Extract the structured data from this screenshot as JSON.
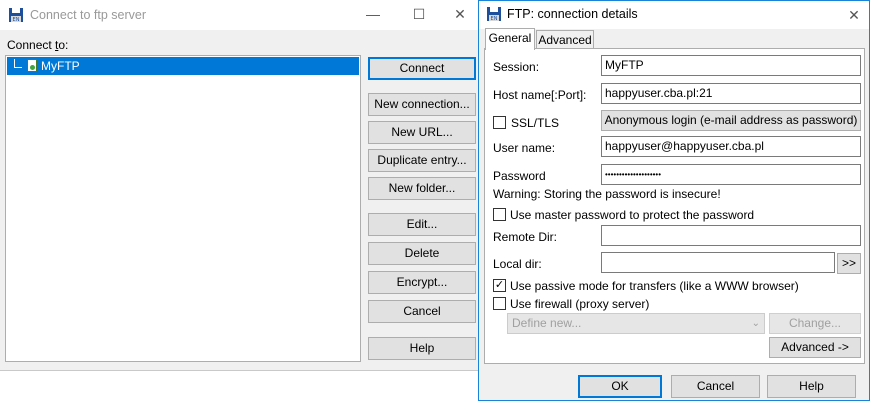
{
  "main_window": {
    "title": "Connect to ftp server",
    "icon": "floppy-disk-icon",
    "controls": {
      "minimize": "—",
      "maximize": "☐",
      "close": "✕"
    },
    "connect_to_label_pre": "Connect ",
    "connect_to_label_ul": "t",
    "connect_to_label_post": "o:",
    "tree_items": [
      {
        "label": "MyFTP",
        "icon": "ftp-site-icon",
        "selected": true
      }
    ],
    "buttons": {
      "connect": "Connect",
      "new_connection": "New connection...",
      "new_url": "New URL...",
      "duplicate_entry": "Duplicate entry...",
      "new_folder": "New folder...",
      "edit": "Edit...",
      "delete": "Delete",
      "encrypt": "Encrypt...",
      "cancel": "Cancel",
      "help": "Help"
    }
  },
  "dialog": {
    "title": "FTP: connection details",
    "close": "✕",
    "tabs": [
      "General",
      "Advanced"
    ],
    "active_tab": "General",
    "session_label": "Session:",
    "session_value": "MyFTP",
    "host_label": "Host name[:Port]:",
    "host_value": "happyuser.cba.pl:21",
    "ssl_label": "SSL/TLS",
    "ssl_checked": false,
    "anonymous_button": "Anonymous login (e-mail address as password)",
    "username_label": "User name:",
    "username_value": "happyuser@happyuser.cba.pl",
    "password_label": "Password",
    "password_value": "••••••••••••••••••••",
    "warning_text": "Warning: Storing the password is insecure!",
    "master_password_label": "Use master password to protect the password",
    "master_password_checked": false,
    "remote_dir_label": "Remote Dir:",
    "remote_dir_value": "",
    "local_dir_label": "Local dir:",
    "local_dir_value": "",
    "browse_button": ">>",
    "passive_label": "Use passive mode for transfers (like a WWW browser)",
    "passive_checked": true,
    "firewall_label": "Use firewall (proxy server)",
    "firewall_checked": false,
    "define_select": "Define new...",
    "change_button": "Change...",
    "advanced_button": "Advanced ->",
    "ok_button": "OK",
    "cancel_button": "Cancel",
    "help_button": "Help"
  }
}
